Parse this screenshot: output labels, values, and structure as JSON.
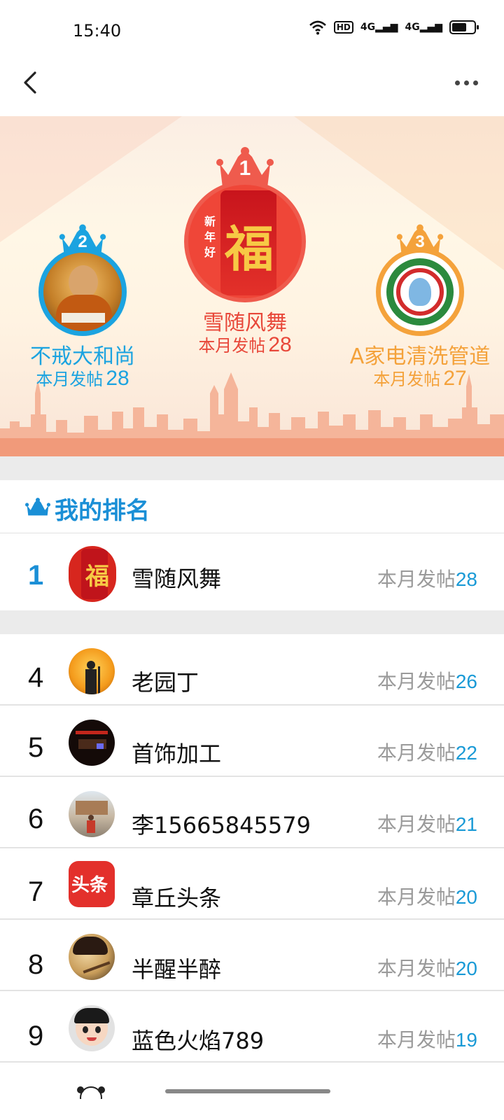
{
  "status": {
    "time": "15:40",
    "network": "HD",
    "signal1": "4G",
    "signal2": "4G"
  },
  "nav": {
    "back_icon": "chevron-left-icon",
    "more_icon": "more-dots-icon"
  },
  "podium": {
    "first": {
      "rank": "1",
      "name": "雪随风舞",
      "count_label": "本月发帖",
      "count": "28",
      "color": "#e8483a",
      "avatar_text": "新年好",
      "avatar_char": "福"
    },
    "second": {
      "rank": "2",
      "name": "不戒大和尚",
      "count_label": "本月发帖",
      "count": "28",
      "color": "#1ba3e0"
    },
    "third": {
      "rank": "3",
      "name": "A家电清洗管道",
      "count_label": "本月发帖",
      "count": "27",
      "color": "#f4a23b"
    }
  },
  "my_rank": {
    "title": "我的排名",
    "row": {
      "rank": "1",
      "name": "雪随风舞",
      "count_label": "本月发帖",
      "count": "28"
    }
  },
  "ranking": [
    {
      "rank": "4",
      "name": "老园丁",
      "count_label": "本月发帖",
      "count": "26"
    },
    {
      "rank": "5",
      "name": "首饰加工",
      "count_label": "本月发帖",
      "count": "22"
    },
    {
      "rank": "6",
      "name": "李15665845579",
      "count_label": "本月发帖",
      "count": "21"
    },
    {
      "rank": "7",
      "name": "章丘头条",
      "count_label": "本月发帖",
      "count": "20",
      "avatar_text": "头条"
    },
    {
      "rank": "8",
      "name": "半醒半醉",
      "count_label": "本月发帖",
      "count": "20"
    },
    {
      "rank": "9",
      "name": "蓝色火焰789",
      "count_label": "本月发帖",
      "count": "19"
    }
  ],
  "colors": {
    "accent": "#1a8fd6",
    "gold": "#f4a23b",
    "red": "#e8483a"
  }
}
